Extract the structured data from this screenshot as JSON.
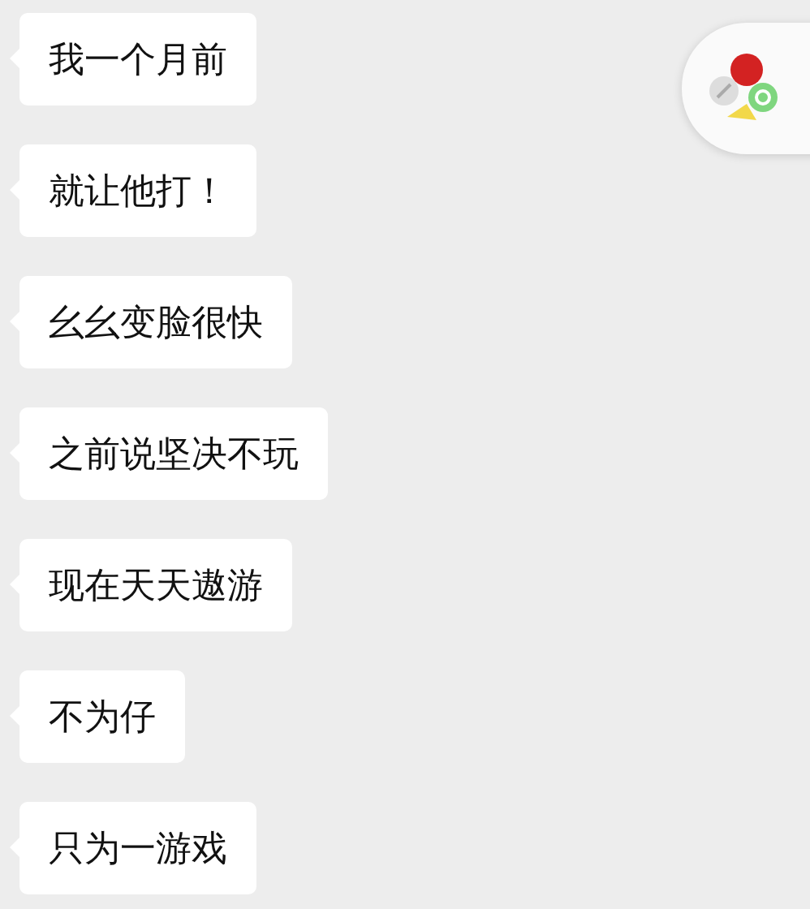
{
  "messages": [
    {
      "text": "我一个月前"
    },
    {
      "text": "就让他打！"
    },
    {
      "text": "幺幺变脸很快"
    },
    {
      "text": "之前说坚决不玩"
    },
    {
      "text": "现在天天遨游"
    },
    {
      "text": "不为仔"
    },
    {
      "text": "只为一游戏"
    }
  ]
}
